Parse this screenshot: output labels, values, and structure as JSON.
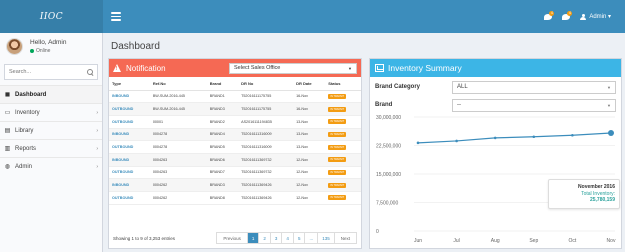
{
  "app": {
    "logo": "IIOC"
  },
  "header": {
    "notification_count_1": "4",
    "notification_count_2": "4",
    "user_menu_label": "Admin ▾"
  },
  "sidebar": {
    "greeting": "Hello, Admin",
    "status": "Online",
    "search_placeholder": "Search...",
    "items": [
      {
        "icon": "dashboard-icon",
        "glyph": "◼",
        "label": "Dashboard",
        "has_children": false
      },
      {
        "icon": "inventory-icon",
        "glyph": "▭",
        "label": "Inventory",
        "has_children": true
      },
      {
        "icon": "library-icon",
        "glyph": "▤",
        "label": "Library",
        "has_children": true
      },
      {
        "icon": "reports-icon",
        "glyph": "▥",
        "label": "Reports",
        "has_children": true
      },
      {
        "icon": "admin-icon",
        "glyph": "◍",
        "label": "Admin",
        "has_children": true
      }
    ]
  },
  "page": {
    "title": "Dashboard"
  },
  "notification": {
    "title": "Notification",
    "select_value": "Select Sales Office",
    "columns": [
      "Type",
      "Ref.No",
      "Brand",
      "DR No",
      "DR Date",
      "Status"
    ],
    "rows": [
      [
        "INBOUND",
        "BW-SUM-2016-445",
        "BRAND1",
        "T52016111175755",
        "16-Nov",
        "IN TRANSIT"
      ],
      [
        "OUTBOUND",
        "BW-SUM-2016-445",
        "BRAND3",
        "T52016111175755",
        "16-Nov",
        "IN TRANSIT"
      ],
      [
        "OUTBOUND",
        "00001",
        "BRAND2",
        "AS2016111194835",
        "13-Nov",
        "IN TRANSIT"
      ],
      [
        "INBOUND",
        "0004278",
        "BRAND4",
        "T52016111316009",
        "13-Nov",
        "IN TRANSIT"
      ],
      [
        "OUTBOUND",
        "0004278",
        "BRAND5",
        "T52016111316009",
        "13-Nov",
        "IN TRANSIT"
      ],
      [
        "INBOUND",
        "0004263",
        "BRAND6",
        "T52016111369732",
        "12-Nov",
        "IN TRANSIT"
      ],
      [
        "OUTBOUND",
        "0004263",
        "BRAND7",
        "T52016111369732",
        "12-Nov",
        "IN TRANSIT"
      ],
      [
        "INBOUND",
        "0004262",
        "BRAND3",
        "T52016111369426",
        "12-Nov",
        "IN TRANSIT"
      ],
      [
        "OUTBOUND",
        "0004262",
        "BRAND8",
        "T52016111369426",
        "12-Nov",
        "IN TRANSIT"
      ]
    ],
    "showing": "Showing 1 to 9 of 3,253 entries",
    "pagination": [
      "Previous",
      "1",
      "2",
      "3",
      "4",
      "5",
      "...",
      "135",
      "Next"
    ],
    "current_page": "1"
  },
  "inventory": {
    "title": "Inventory Summary",
    "brand_category_label": "Brand Category",
    "brand_category_value": "ALL",
    "brand_label": "Brand",
    "brand_value": "--",
    "tooltip": {
      "date": "November 2016",
      "label": "Total Inventory:",
      "value": "25,780,159"
    }
  },
  "chart_data": {
    "type": "line",
    "categories": [
      "Jun",
      "Jul",
      "Aug",
      "Sep",
      "Oct",
      "Nov"
    ],
    "series": [
      {
        "values": [
          23200000,
          23700000,
          24500000,
          24800000,
          25200000,
          25780159
        ]
      }
    ],
    "yticks": [
      "30,000,000",
      "22,500,000",
      "15,000,000",
      "7,500,000",
      "0"
    ],
    "ylim": [
      0,
      30000000
    ],
    "line_color": "#3c8dbc"
  }
}
